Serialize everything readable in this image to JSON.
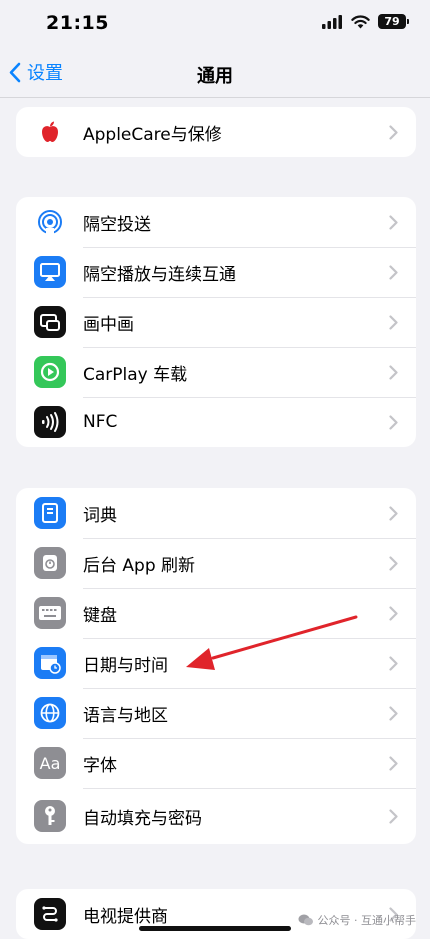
{
  "status_bar": {
    "time": "21:15",
    "battery": "79",
    "icons": [
      "signal-icon",
      "wifi-icon",
      "battery-icon"
    ]
  },
  "nav": {
    "back_label": "设置",
    "title": "通用"
  },
  "groups": [
    {
      "items": [
        {
          "label": "AppleCare与保修",
          "icon": "apple-logo-icon",
          "icon_bg": "#ffffff"
        }
      ]
    },
    {
      "items": [
        {
          "label": "隔空投送",
          "icon": "airdrop-icon",
          "icon_bg": "#ffffff"
        },
        {
          "label": "隔空播放与连续互通",
          "icon": "airplay-icon",
          "icon_bg": "#1b7cf5"
        },
        {
          "label": "画中画",
          "icon": "picture-in-picture-icon",
          "icon_bg": "#111111"
        },
        {
          "label": "CarPlay 车载",
          "icon": "carplay-icon",
          "icon_bg": "#34c759"
        },
        {
          "label": "NFC",
          "icon": "nfc-icon",
          "icon_bg": "#111111"
        }
      ]
    },
    {
      "items": [
        {
          "label": "词典",
          "icon": "dictionary-icon",
          "icon_bg": "#1b7cf5"
        },
        {
          "label": "后台 App 刷新",
          "icon": "background-refresh-icon",
          "icon_bg": "#8e8e93"
        },
        {
          "label": "键盘",
          "icon": "keyboard-icon",
          "icon_bg": "#8e8e93"
        },
        {
          "label": "日期与时间",
          "icon": "calendar-clock-icon",
          "icon_bg": "#1b7cf5"
        },
        {
          "label": "语言与地区",
          "icon": "globe-icon",
          "icon_bg": "#1b7cf5"
        },
        {
          "label": "字体",
          "icon": "font-icon",
          "icon_bg": "#8e8e93",
          "icon_text": "Aa"
        },
        {
          "label": "自动填充与密码",
          "icon": "key-icon",
          "icon_bg": "#8e8e93"
        }
      ]
    },
    {
      "items": [
        {
          "label": "电视提供商",
          "icon": "tv-provider-icon",
          "icon_bg": "#111111"
        }
      ]
    }
  ],
  "watermark": "公众号 · 互通小帮手",
  "colors": {
    "accent": "#0a84ff",
    "annotation_arrow": "#e0242b",
    "background": "#f2f2f6"
  }
}
